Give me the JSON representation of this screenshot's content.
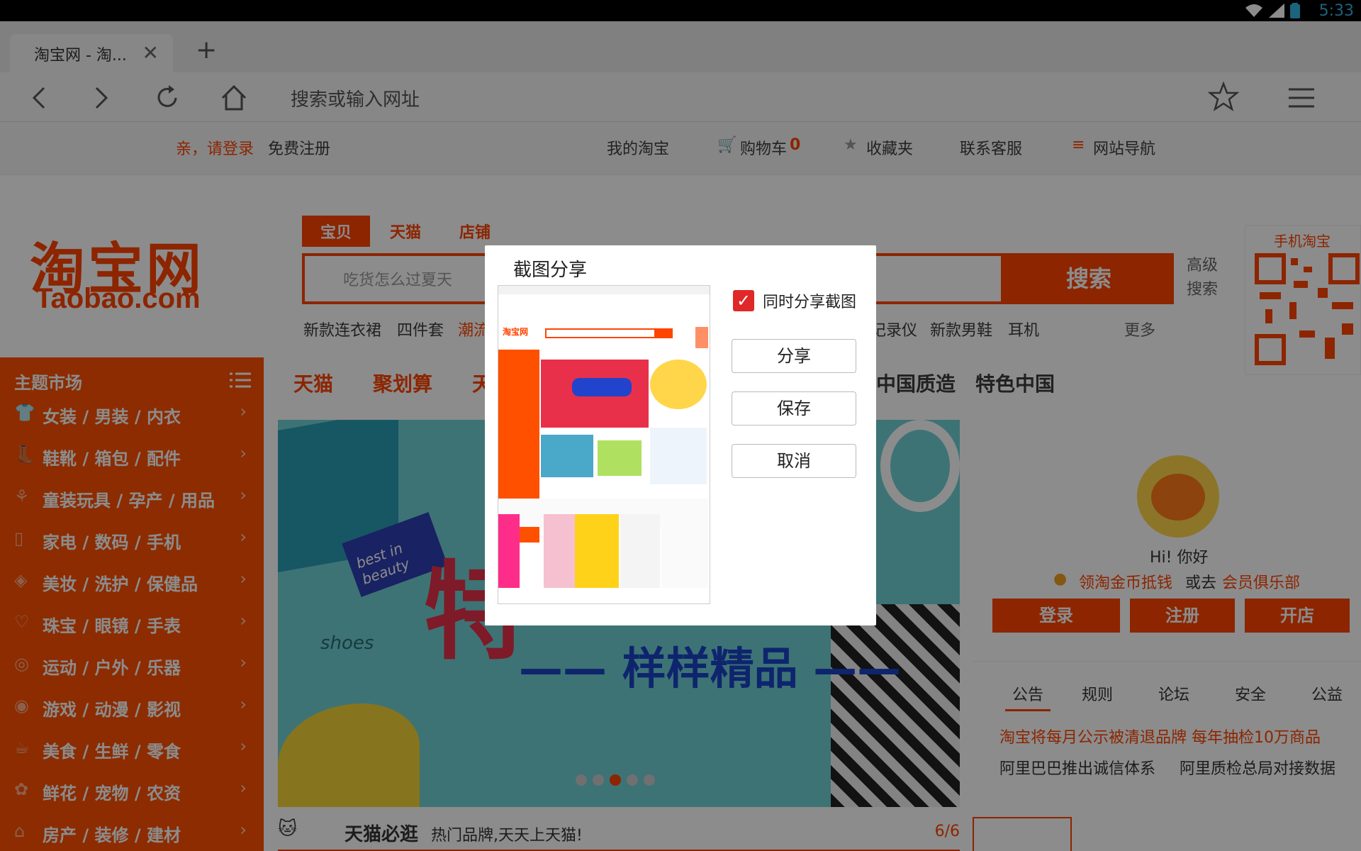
{
  "status": {
    "time": "5:33",
    "icons": [
      "wifi-icon",
      "signal-icon",
      "battery-icon"
    ]
  },
  "tab": {
    "title": "淘宝网 - 淘...",
    "close": "✕",
    "new_tab": "+"
  },
  "addressbar": {
    "placeholder": "搜索或输入网址"
  },
  "page": {
    "topbar": {
      "login": "亲，请登录",
      "register": "免费注册",
      "my_taobao": "我的淘宝",
      "cart": "购物车",
      "cart_count": "0",
      "favorites": "收藏夹",
      "service": "联系客服",
      "sitenav": "网站导航"
    },
    "logo": {
      "cn": "淘宝网",
      "en": "Taobao.com"
    },
    "search": {
      "tabs": [
        "宝贝",
        "天猫",
        "店铺"
      ],
      "placeholder": "吃货怎么过夏天",
      "button": "搜索",
      "advanced": "高级\n搜索",
      "hot": [
        "新款连衣裙",
        "四件套",
        "潮流",
        "记录仪",
        "新款男鞋",
        "耳机"
      ],
      "more": "更多"
    },
    "qr": {
      "title": "手机淘宝"
    },
    "categories": {
      "title": "主题市场",
      "items": [
        "女装 / 男装 / 内衣",
        "鞋靴 / 箱包 / 配件",
        "童装玩具 / 孕产 / 用品",
        "家电 / 数码 / 手机",
        "美妆 / 洗护 / 保健品",
        "珠宝 / 眼镜 / 手表",
        "运动 / 户外 / 乐器",
        "游戏 / 动漫 / 影视",
        "美食 / 生鲜 / 零食",
        "鲜花 / 宠物 / 农资",
        "房产 / 装修 / 建材"
      ]
    },
    "channels": [
      "天猫",
      "聚划算",
      "天",
      "中国质造",
      "特色中国"
    ],
    "banner": {
      "big": "特",
      "title": "—— 样样精品 ——",
      "sticker": "best in beauty",
      "shoes": "shoes",
      "counter": "6/6"
    },
    "tmall_strip": {
      "title": "天猫必逛",
      "desc": "热门品牌,天天上天猫!"
    },
    "user": {
      "greeting": "Hi! 你好",
      "coins": "领淘金币抵钱",
      "or": "或去",
      "club": "会员俱乐部",
      "login": "登录",
      "register": "注册",
      "open_shop": "开店"
    },
    "notice": {
      "tabs": [
        "公告",
        "规则",
        "论坛",
        "安全",
        "公益"
      ],
      "line1": "淘宝将每月公示被清退品牌 每年抽检10万商品",
      "line2a": "阿里巴巴推出诚信体系",
      "line2b": "阿里质检总局对接数据"
    }
  },
  "dialog": {
    "title": "截图分享",
    "checkbox_label": "同时分享截图",
    "checked": true,
    "share": "分享",
    "save": "保存",
    "cancel": "取消"
  },
  "colors": {
    "taobao_orange": "#ff4400",
    "check_red": "#e02828"
  }
}
